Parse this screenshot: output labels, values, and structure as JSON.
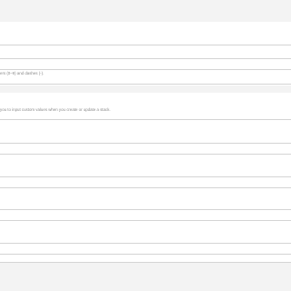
{
  "stack_name_section": {
    "name_constraint_hint": "ers (0–9) and dashes (-)."
  },
  "parameters_section": {
    "description": "you to input custom values when you create or update a stack."
  }
}
